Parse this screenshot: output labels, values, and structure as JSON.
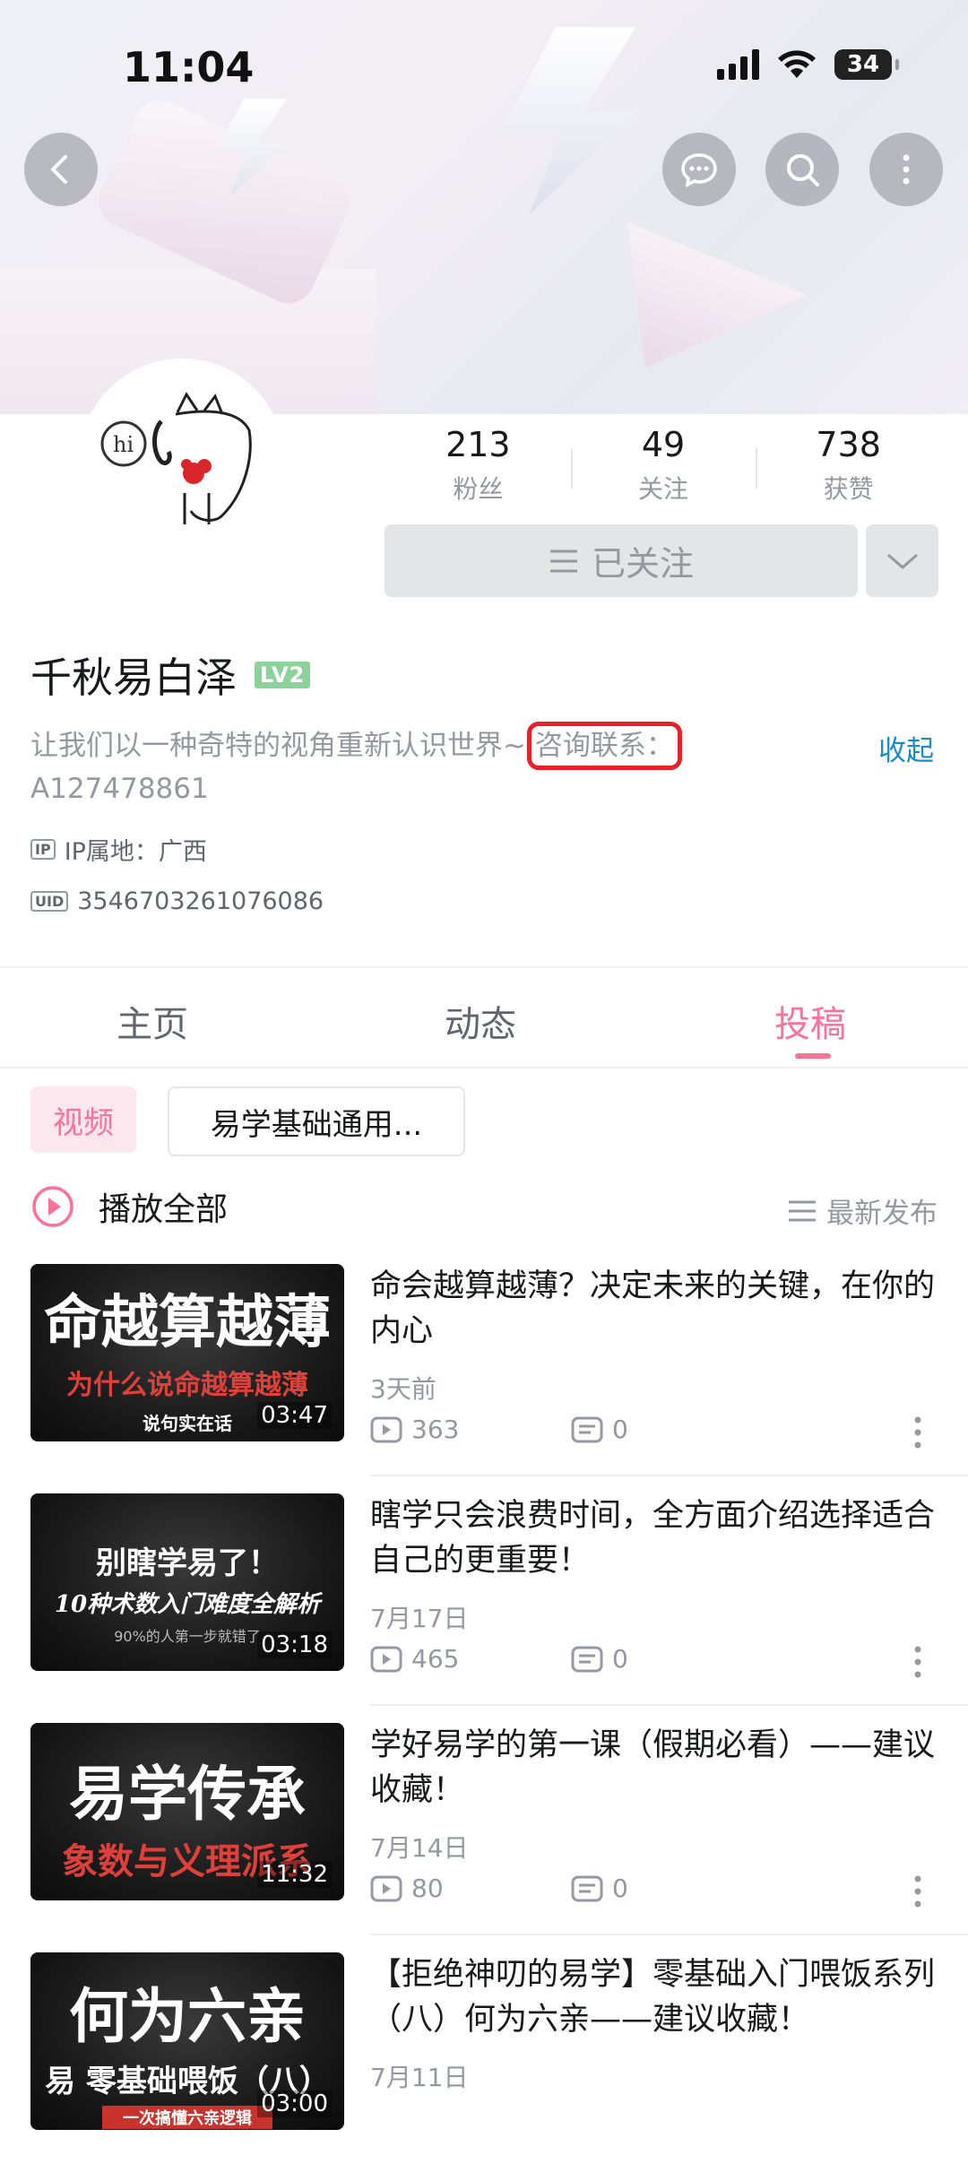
{
  "status_bar": {
    "time": "11:04",
    "battery": "34",
    "icons": [
      "signal-icon",
      "wifi-icon",
      "battery-icon"
    ]
  },
  "header": {
    "buttons": [
      "back-icon",
      "message-icon",
      "search-icon",
      "more-icon"
    ]
  },
  "profile": {
    "stats": [
      {
        "value": "213",
        "label": "粉丝"
      },
      {
        "value": "49",
        "label": "关注"
      },
      {
        "value": "738",
        "label": "获赞"
      }
    ],
    "follow_label": "已关注",
    "name": "千秋易白泽",
    "level": "LV2",
    "bio": "让我们以一种奇特的视角重新认识世界~",
    "bio_highlight": "咨询联系：",
    "bio_line2": "A127478861",
    "collapse_label": "收起",
    "ip_tag": "IP",
    "ip_location": "IP属地：广西",
    "uid_tag": "UID",
    "uid": "3546703261076086"
  },
  "tabs": [
    {
      "label": "主页",
      "active": false
    },
    {
      "label": "动态",
      "active": false
    },
    {
      "label": "投稿",
      "active": true
    }
  ],
  "filters": {
    "type": "视频",
    "category": "易学基础通用..."
  },
  "list_header": {
    "play_all": "播放全部",
    "sort": "最新发布"
  },
  "videos": [
    {
      "thumb_big": "命越算越薄",
      "thumb_sub": "为什么说命越算越薄",
      "thumb_small": "说句实在话",
      "duration": "03:47",
      "title": "命会越算越薄？决定未来的关键，在你的内心",
      "date": "3天前",
      "views": "363",
      "comments": "0"
    },
    {
      "thumb_big": "别瞎学易了！",
      "thumb_sub": "10种术数入门难度全解析",
      "thumb_small": "90%的人第一步就错了",
      "duration": "03:18",
      "title": "瞎学只会浪费时间，全方面介绍选择适合自己的更重要！",
      "date": "7月17日",
      "views": "465",
      "comments": "0"
    },
    {
      "thumb_big": "易学传承",
      "thumb_sub": "象数与义理派系",
      "thumb_small": "",
      "duration": "11:32",
      "title": "学好易学的第一课（假期必看）——建议收藏！",
      "date": "7月14日",
      "views": "80",
      "comments": "0"
    },
    {
      "thumb_big": "何为六亲",
      "thumb_sub": "易 零基础喂饭（八）",
      "thumb_small": "一次搞懂六亲逻辑",
      "duration": "03:00",
      "title": "【拒绝神叨的易学】零基础入门喂饭系列（八）何为六亲——建议收藏！",
      "date": "7月11日",
      "views": "",
      "comments": ""
    }
  ],
  "colors": {
    "accent": "#fb7299",
    "link": "#178bcf",
    "highlight_box": "#e8202a"
  }
}
